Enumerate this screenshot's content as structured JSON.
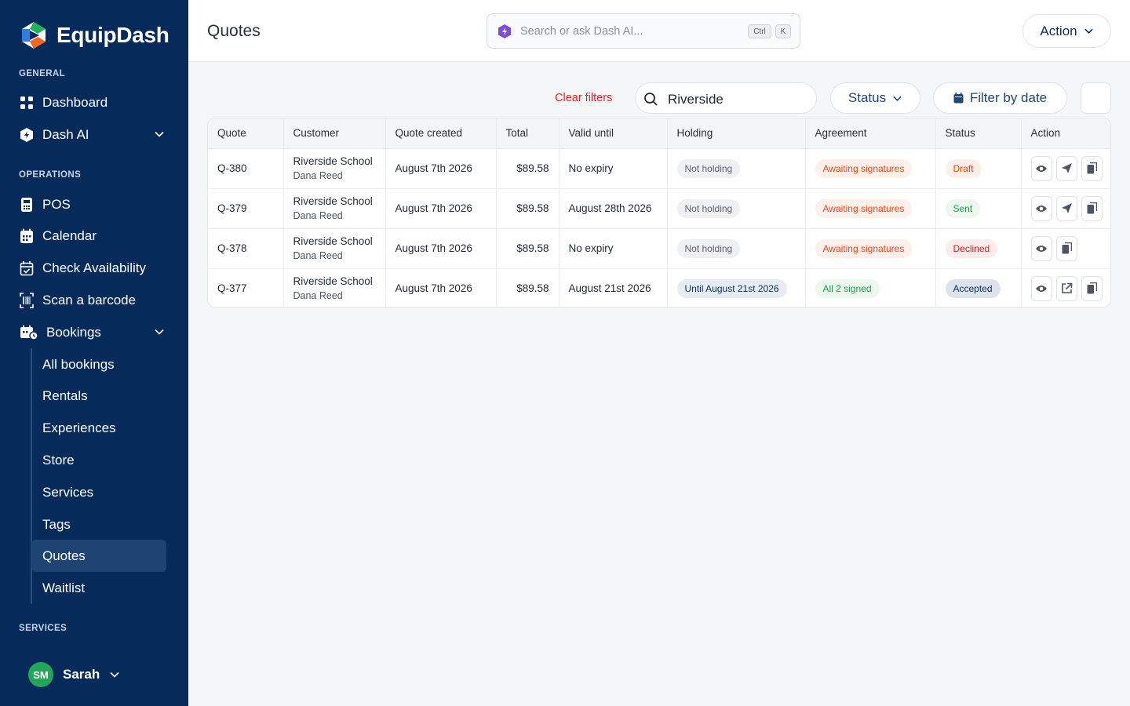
{
  "app": {
    "name": "EquipDash"
  },
  "sidebar": {
    "sections": {
      "general": "GENERAL",
      "operations": "OPERATIONS",
      "services": "SERVICES"
    },
    "general_items": [
      {
        "label": "Dashboard",
        "icon": "grid-icon"
      },
      {
        "label": "Dash AI",
        "icon": "hexagon-bolt-icon"
      }
    ],
    "operations_items": [
      {
        "label": "POS",
        "icon": "pos-icon"
      },
      {
        "label": "Calendar",
        "icon": "calendar-icon"
      },
      {
        "label": "Check Availability",
        "icon": "calendar-check-icon"
      },
      {
        "label": "Scan a barcode",
        "icon": "barcode-scan-icon"
      },
      {
        "label": "Bookings",
        "icon": "bookings-icon"
      }
    ],
    "bookings_sub": [
      "All bookings",
      "Rentals",
      "Experiences",
      "Store",
      "Services",
      "Tags",
      "Quotes",
      "Waitlist"
    ],
    "active_sub": "Quotes",
    "user": {
      "initials": "SM",
      "name": "Sarah"
    }
  },
  "topbar": {
    "title": "Quotes",
    "search_placeholder": "Search or ask Dash AI...",
    "kbd_ctrl": "Ctrl",
    "kbd_k": "K",
    "action_label": "Action"
  },
  "filters": {
    "clear_label": "Clear filters",
    "search_value": "Riverside",
    "status_label": "Status",
    "date_label": "Filter by date"
  },
  "table": {
    "headers": [
      "Quote",
      "Customer",
      "Quote created",
      "Total",
      "Valid until",
      "Holding",
      "Agreement",
      "Status",
      "Action"
    ],
    "rows": [
      {
        "quote": "Q-380",
        "customer": "Riverside School",
        "contact": "Dana Reed",
        "created": "August 7th 2026",
        "total": "$89.58",
        "valid": "No expiry",
        "holding": "Not holding",
        "agreement": "Awaiting signatures",
        "status": "Draft"
      },
      {
        "quote": "Q-379",
        "customer": "Riverside School",
        "contact": "Dana Reed",
        "created": "August 7th 2026",
        "total": "$89.58",
        "valid": "August 28th 2026",
        "holding": "Not holding",
        "agreement": "Awaiting signatures",
        "status": "Sent"
      },
      {
        "quote": "Q-378",
        "customer": "Riverside School",
        "contact": "Dana Reed",
        "created": "August 7th 2026",
        "total": "$89.58",
        "valid": "No expiry",
        "holding": "Not holding",
        "agreement": "Awaiting signatures",
        "status": "Declined"
      },
      {
        "quote": "Q-377",
        "customer": "Riverside School",
        "contact": "Dana Reed",
        "created": "August 7th 2026",
        "total": "$89.58",
        "valid": "August 21st 2026",
        "holding": "Until August 21st 2026",
        "agreement": "All 2 signed",
        "status": "Accepted"
      }
    ]
  },
  "colors": {
    "sidebar_bg": "#062b5a",
    "accent": "#0b2f5e",
    "danger": "#e02424",
    "avatar": "#23a65b"
  }
}
